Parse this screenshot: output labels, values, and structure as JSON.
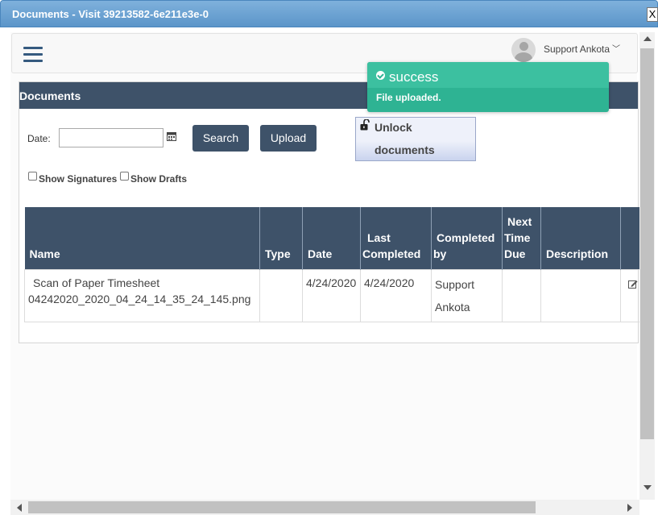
{
  "window": {
    "title": "Documents - Visit 39213582-6e211e3e-0",
    "close_label": "X"
  },
  "navbar": {
    "user_name": "Support Ankota",
    "user_chevron": "﹀"
  },
  "panel": {
    "title": "Documents"
  },
  "filters": {
    "date_label": "Date:",
    "date_value": "",
    "search_label": "Search",
    "upload_label": "Upload",
    "unlock_line1": "Unlock",
    "unlock_line2": "documents",
    "show_signatures": "Show Signatures",
    "show_drafts": "Show Drafts"
  },
  "table": {
    "columns": {
      "name": "Name",
      "type": "Type",
      "date": "Date",
      "last_completed_1": "Last",
      "last_completed_2": "Completed",
      "completed_by_1": "Completed",
      "completed_by_2": "by",
      "next_due_1": "Next",
      "next_due_2": "Time",
      "next_due_3": "Due",
      "description": "Description"
    },
    "rows": [
      {
        "name_line1": "Scan of Paper Timesheet",
        "name_line2": "04242020_2020_04_24_14_35_24_145.png",
        "type": "",
        "date": "4/24/2020",
        "last_completed": "4/24/2020",
        "completed_by_1": "Support",
        "completed_by_2": "Ankota",
        "next_due": "",
        "description": ""
      }
    ]
  },
  "toast": {
    "heading": "success",
    "message": "File uploaded."
  },
  "colors": {
    "header_dark": "#3e5269",
    "toast_green": "#2eb393",
    "titlebar_blue": "#5b95c9"
  }
}
